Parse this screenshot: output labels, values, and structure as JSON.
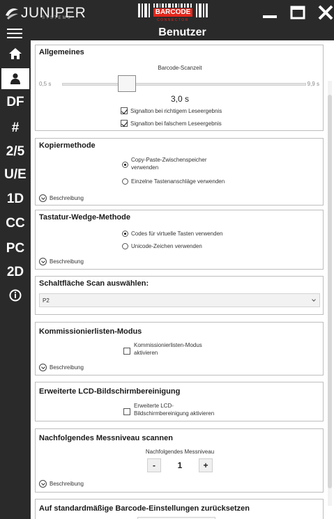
{
  "titlebar": {
    "logo_text": "JUNIPER",
    "logo_sub": "SYSTEMS",
    "product_label": "BARCODE",
    "product_sub": "CONNECTOR"
  },
  "header": {
    "title": "Benutzer"
  },
  "sidebar": {
    "items": [
      {
        "label": "",
        "icon": "home-icon"
      },
      {
        "label": "",
        "icon": "user-icon"
      },
      {
        "label": "DF"
      },
      {
        "label": "#"
      },
      {
        "label": "2/5"
      },
      {
        "label": "U/E"
      },
      {
        "label": "1D"
      },
      {
        "label": "CC"
      },
      {
        "label": "PC"
      },
      {
        "label": "2D"
      },
      {
        "label": "",
        "icon": "info-icon"
      }
    ]
  },
  "general": {
    "title": "Allgemeines",
    "slider_label": "Barcode-Scanzeit",
    "min": "0,5 s",
    "max": "9,9 s",
    "value_text": "3,0 s",
    "slider_value": 3.0,
    "check1": "Signalton bei richtigem Leseergebnis",
    "check2": "Signalton bei falschem Leseergebnis"
  },
  "copy_method": {
    "title": "Kopiermethode",
    "opt1": "Copy-Paste-Zwischenspeicher",
    "opt1b": "verwenden",
    "opt2": "Einzelne Tastenanschläge verwenden",
    "desc": "Beschreibung"
  },
  "wedge": {
    "title": "Tastatur-Wedge-Methode",
    "opt1": "Codes für virtuelle Tasten verwenden",
    "opt2": "Unicode-Zeichen verwenden",
    "desc": "Beschreibung"
  },
  "scan_button": {
    "title": "Schaltfläche Scan auswählen:",
    "value": "P2"
  },
  "picklist": {
    "title": "Kommissionierlisten-Modus",
    "check1": "Kommissionierlisten-Modus",
    "check1b": "aktivieren",
    "desc": "Beschreibung"
  },
  "lcd": {
    "title": "Erweiterte LCD-Bildschirmbereinigung",
    "check1": "Erweiterte LCD-",
    "check1b": "Bildschirmbereinigung aktivieren"
  },
  "level": {
    "title": "Nachfolgendes Messniveau scannen",
    "label": "Nachfolgendes Messniveau",
    "minus": "-",
    "value": "1",
    "plus": "+",
    "desc": "Beschreibung"
  },
  "reset": {
    "title": "Auf standardmäßige Barcode-Einstellungen zurücksetzen"
  },
  "colors": {
    "dark": "#2a2a2a",
    "accent_red": "#e3271c"
  }
}
